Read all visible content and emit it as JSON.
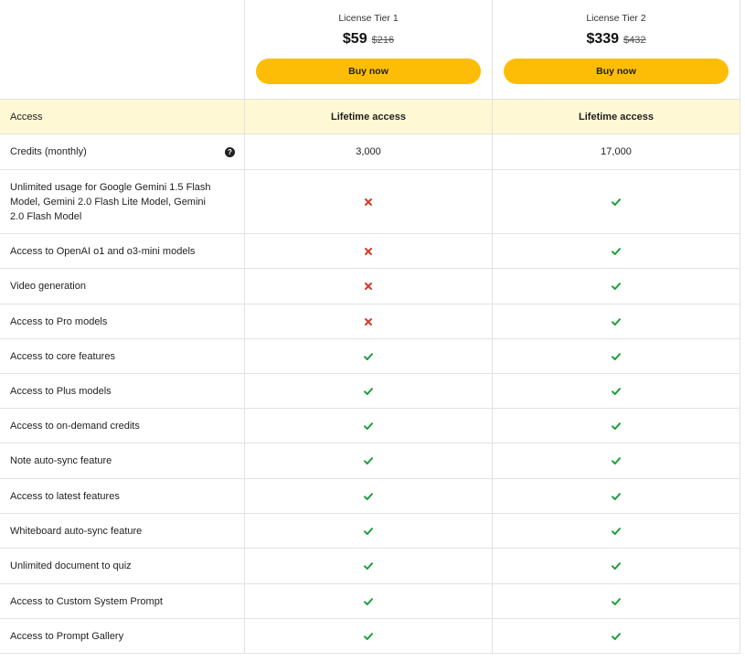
{
  "plans": [
    {
      "name": "License Tier 1",
      "price": "$59",
      "old_price": "$216",
      "button": "Buy now"
    },
    {
      "name": "License Tier 2",
      "price": "$339",
      "old_price": "$432",
      "button": "Buy now"
    }
  ],
  "access_row": {
    "label": "Access",
    "values": [
      "Lifetime access",
      "Lifetime access"
    ]
  },
  "credits_row": {
    "label": "Credits (monthly)",
    "help_icon": "?",
    "values": [
      "3,000",
      "17,000"
    ]
  },
  "feature_rows": [
    {
      "label": "Unlimited usage for Google Gemini 1.5 Flash Model, Gemini 2.0 Flash Lite Model, Gemini 2.0 Flash Model",
      "tier1": false,
      "tier2": true
    },
    {
      "label": "Access to OpenAI o1 and o3-mini models",
      "tier1": false,
      "tier2": true
    },
    {
      "label": "Video generation",
      "tier1": false,
      "tier2": true
    },
    {
      "label": "Access to Pro models",
      "tier1": false,
      "tier2": true
    },
    {
      "label": "Access to core features",
      "tier1": true,
      "tier2": true
    },
    {
      "label": "Access to Plus models",
      "tier1": true,
      "tier2": true
    },
    {
      "label": "Access to on-demand credits",
      "tier1": true,
      "tier2": true
    },
    {
      "label": "Note auto-sync feature",
      "tier1": true,
      "tier2": true
    },
    {
      "label": "Access to latest features",
      "tier1": true,
      "tier2": true
    },
    {
      "label": "Whiteboard auto-sync feature",
      "tier1": true,
      "tier2": true
    },
    {
      "label": "Unlimited document to quiz",
      "tier1": true,
      "tier2": true
    },
    {
      "label": "Access to Custom System Prompt",
      "tier1": true,
      "tier2": true
    },
    {
      "label": "Access to Prompt Gallery",
      "tier1": true,
      "tier2": true
    }
  ],
  "icons": {
    "yes": "check-icon",
    "no": "cross-icon"
  },
  "colors": {
    "check": "#1e9e3e",
    "cross": "#d23b2a",
    "button": "#fdbd07",
    "highlight": "#fef8d5"
  }
}
